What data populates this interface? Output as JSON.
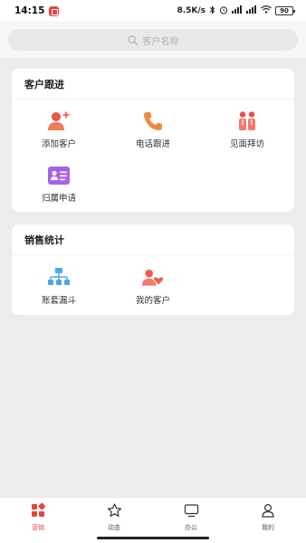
{
  "status_bar": {
    "time": "14:15",
    "net_speed": "8.5K/s",
    "battery": "90",
    "icons": [
      "bluetooth-icon",
      "alarm-icon",
      "signal-icon",
      "signal-icon",
      "wifi-icon",
      "battery-icon"
    ]
  },
  "search": {
    "placeholder": "客户名称",
    "icon": "search-icon"
  },
  "sections": [
    {
      "title": "客户跟进",
      "items": [
        {
          "label": "添加客户",
          "icon": "add-customer-icon",
          "color": "#f0553e"
        },
        {
          "label": "电话跟进",
          "icon": "phone-icon",
          "color": "#f08a3c"
        },
        {
          "label": "见面拜访",
          "icon": "visit-icon",
          "color": "#ee4d4d"
        },
        {
          "label": "归属申请",
          "icon": "id-card-icon",
          "color": "#9b59e6"
        }
      ]
    },
    {
      "title": "销售统计",
      "items": [
        {
          "label": "账套漏斗",
          "icon": "hierarchy-icon",
          "color": "#4aa8ea"
        },
        {
          "label": "我的客户",
          "icon": "my-customer-icon",
          "color": "#ee5b4b"
        }
      ]
    }
  ],
  "tabbar": {
    "tabs": [
      {
        "label": "营销",
        "icon": "apps-icon",
        "active": true
      },
      {
        "label": "动态",
        "icon": "star-icon",
        "active": false
      },
      {
        "label": "办公",
        "icon": "monitor-icon",
        "active": false
      },
      {
        "label": "我的",
        "icon": "person-icon",
        "active": false
      }
    ]
  },
  "colors": {
    "accent": "#e8453c",
    "background": "#ececec",
    "card": "#ffffff"
  }
}
